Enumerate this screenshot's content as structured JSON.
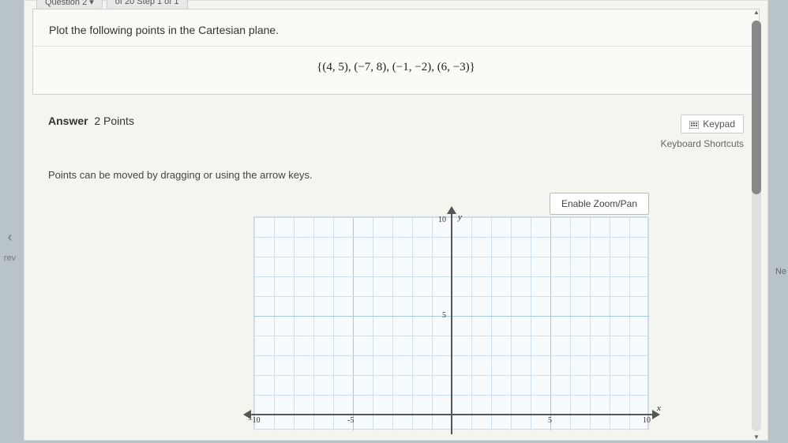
{
  "nav": {
    "question_tab": "Question 2 ▾",
    "step_tab": "of 20 Step 1 of 1"
  },
  "instruction": "Plot the following points in the Cartesian plane.",
  "points_set": "{(4, 5), (−7, 8), (−1, −2), (6, −3)}",
  "answer": {
    "label": "Answer",
    "points": "2 Points"
  },
  "keypad": {
    "button": "Keypad",
    "shortcuts": "Keyboard Shortcuts"
  },
  "hint": "Points can be moved by dragging or using the arrow keys.",
  "zoom_button": "Enable Zoom/Pan",
  "graph": {
    "y_label": "y",
    "x_label": "x",
    "ticks": {
      "y10": "10",
      "y5": "5",
      "xn10": "−10",
      "xn5": "-5",
      "x5": "5",
      "x10": "10"
    }
  },
  "prev_nav": {
    "arrow": "‹",
    "label": "rev"
  },
  "next_label": "Ne",
  "chart_data": {
    "type": "scatter",
    "title": "Cartesian plane",
    "xlabel": "x",
    "ylabel": "y",
    "xlim": [
      -10,
      10
    ],
    "ylim": [
      -10,
      10
    ],
    "grid": true,
    "points_to_plot": [
      {
        "x": 4,
        "y": 5
      },
      {
        "x": -7,
        "y": 8
      },
      {
        "x": -1,
        "y": -2
      },
      {
        "x": 6,
        "y": -3
      }
    ],
    "visible_region": "upper half (y >= -1 approx)",
    "plotted_points_visible": []
  }
}
